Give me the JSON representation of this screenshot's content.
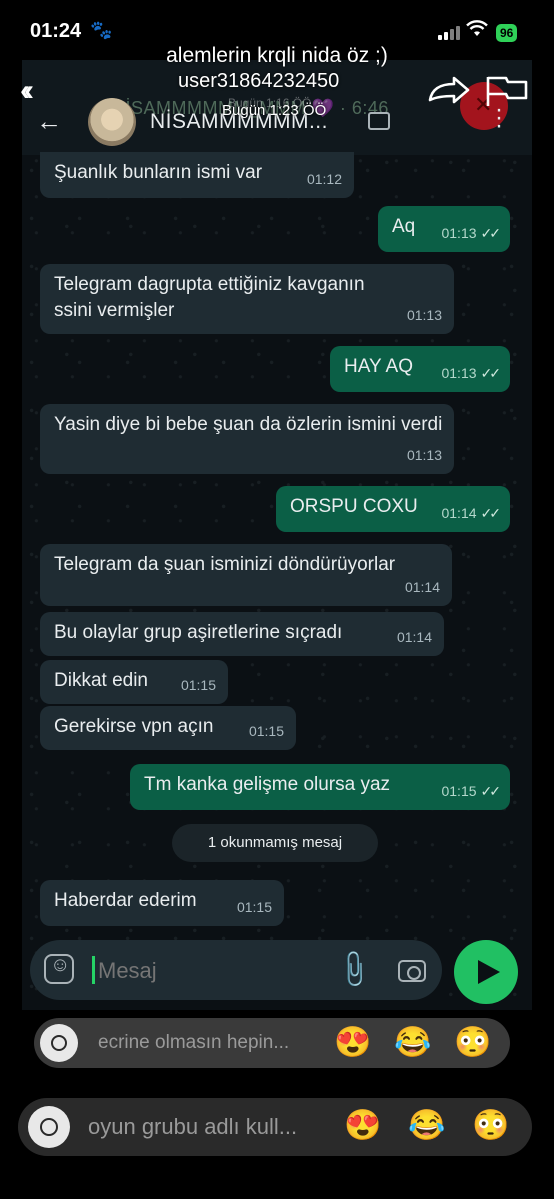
{
  "status_bar": {
    "time": "01:24",
    "battery": "96"
  },
  "story": {
    "caption": "alemlerin krqli nida öz ;)",
    "username": "user31864232450",
    "date": "Bugün 1:23 ÖÖ",
    "ghost_date": "Bugün 1:16 ÖÖ"
  },
  "recording": {
    "notification_ghost": "NİSAMMMMMM_MMM 💜 · 6:46",
    "chat_name": "NİSAMMMMMM..."
  },
  "messages": [
    {
      "dir": "in",
      "text": "Şuanlık bunların ismi var",
      "time": "01:12"
    },
    {
      "dir": "out",
      "text": "Aq",
      "time": "01:13"
    },
    {
      "dir": "in",
      "text": "Telegram dagrupta ettiğiniz kavganın ssini vermişler",
      "time": "01:13"
    },
    {
      "dir": "out",
      "text": "HAY AQ",
      "time": "01:13"
    },
    {
      "dir": "in",
      "text": "Yasin diye bi bebe şuan da özlerin ismini verdi",
      "time": "01:13"
    },
    {
      "dir": "out",
      "text": "ORSPU COXU",
      "time": "01:14"
    },
    {
      "dir": "in",
      "text": "Telegram da şuan isminizi döndürüyorlar",
      "time": "01:14"
    },
    {
      "dir": "in",
      "text": "Bu olaylar grup aşiretlerine sıçradı",
      "time": "01:14"
    },
    {
      "dir": "in",
      "text": "Dikkat edin",
      "time": "01:15"
    },
    {
      "dir": "in",
      "text": "Gerekirse vpn açın",
      "time": "01:15"
    },
    {
      "dir": "out",
      "text": "Tm kanka gelişme olursa yaz",
      "time": "01:15"
    },
    {
      "dir": "in",
      "text": "Haberdar ederim",
      "time": "01:15"
    }
  ],
  "unread_label": "1 okunmamış mesaj",
  "composer": {
    "placeholder": "Mesaj"
  },
  "inner_reply": {
    "text": "ecrine olmasın hepin...",
    "emojis": [
      "😍",
      "😂",
      "😳"
    ]
  },
  "outer_reply": {
    "text": "oyun grubu adlı kull...",
    "emojis": [
      "😍",
      "😂",
      "😳"
    ]
  },
  "icons": {
    "paw": "🐾",
    "wifi": "wifi-icon",
    "back": "arrow-left-icon",
    "video": "video-call-icon",
    "menu": "more-vert-icon",
    "clip": "attach-icon",
    "camera": "camera-icon",
    "send": "send-icon",
    "share": "share-icon",
    "flag": "report-flag-icon"
  },
  "colors": {
    "outgoing_bubble": "#0b5f46",
    "incoming_bubble": "#1f2c33",
    "send_button": "#21c063",
    "battery": "#2fd158"
  }
}
